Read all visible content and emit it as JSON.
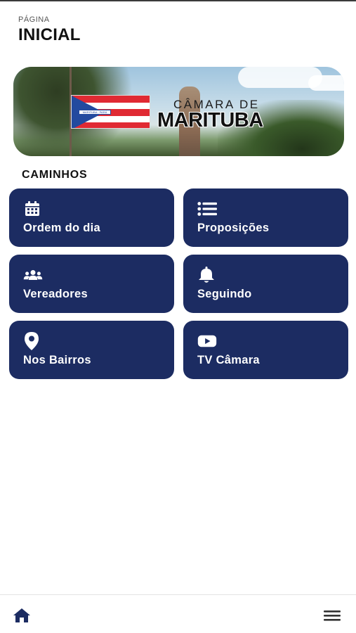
{
  "header": {
    "subtitle": "PÁGINA",
    "title": "INICIAL"
  },
  "banner": {
    "line1": "CÂMARA DE",
    "line2": "MARITUBA",
    "flag_band_text": "MARITUBA - PARÁ"
  },
  "section": {
    "title": "CAMINHOS"
  },
  "tiles": [
    {
      "label": "Ordem do dia",
      "icon": "calendar-icon"
    },
    {
      "label": "Proposições",
      "icon": "list-icon"
    },
    {
      "label": "Vereadores",
      "icon": "users-icon"
    },
    {
      "label": "Seguindo",
      "icon": "bell-icon"
    },
    {
      "label": "Nos Bairros",
      "icon": "map-pin-icon"
    },
    {
      "label": "TV Câmara",
      "icon": "youtube-icon"
    }
  ],
  "bottom_nav": {
    "home_icon": "home-icon",
    "menu_icon": "hamburger-menu-icon"
  },
  "colors": {
    "tile_background": "#1c2c62",
    "home_icon": "#1c2c62",
    "text": "#111111"
  }
}
